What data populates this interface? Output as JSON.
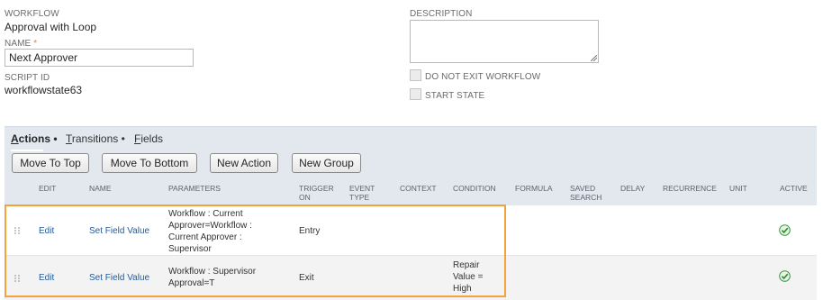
{
  "form": {
    "workflow_label": "WORKFLOW",
    "workflow_value": "Approval with Loop",
    "name_label": "NAME",
    "name_required_marker": "*",
    "name_value": "Next Approver",
    "script_id_label": "SCRIPT ID",
    "script_id_value": "workflowstate63",
    "description_label": "DESCRIPTION",
    "description_value": "",
    "do_not_exit_label": "DO NOT EXIT WORKFLOW",
    "do_not_exit_checked": false,
    "start_state_label": "START STATE",
    "start_state_checked": false
  },
  "tabs": [
    {
      "pre": "",
      "underlined": "A",
      "rest": "ctions",
      "dot": "•",
      "active": true
    },
    {
      "pre": "",
      "underlined": "T",
      "rest": "ransitions",
      "dot": "•",
      "active": false
    },
    {
      "pre": "",
      "underlined": "F",
      "rest": "ields",
      "dot": "",
      "active": false
    }
  ],
  "toolbar": {
    "move_top": "Move To Top",
    "move_bottom": "Move To Bottom",
    "new_action": "New Action",
    "new_group": "New Group"
  },
  "columns": {
    "edit": "EDIT",
    "name": "NAME",
    "parameters": "PARAMETERS",
    "trigger_on": "TRIGGER ON",
    "event_type": "EVENT TYPE",
    "context": "CONTEXT",
    "condition": "CONDITION",
    "formula": "FORMULA",
    "saved_search": "SAVED SEARCH",
    "delay": "DELAY",
    "recurrence": "RECURRENCE",
    "unit": "UNIT",
    "active": "ACTIVE"
  },
  "rows": [
    {
      "edit": "Edit",
      "name": "Set Field Value",
      "parameters": [
        "Workflow : Current",
        "Approver=Workflow :",
        "Current Approver :",
        "Supervisor"
      ],
      "trigger_on": "Entry",
      "condition": [],
      "active": true
    },
    {
      "edit": "Edit",
      "name": "Set Field Value",
      "parameters": [
        "Workflow : Supervisor",
        "Approval=T"
      ],
      "trigger_on": "Exit",
      "condition": [
        "Repair",
        "Value =",
        "High"
      ],
      "active": true
    }
  ],
  "colors": {
    "accent_link": "#255b9a",
    "highlight": "#f4a33c",
    "panel_bg": "#e3e8ef",
    "check_green": "#3a9b3a"
  }
}
